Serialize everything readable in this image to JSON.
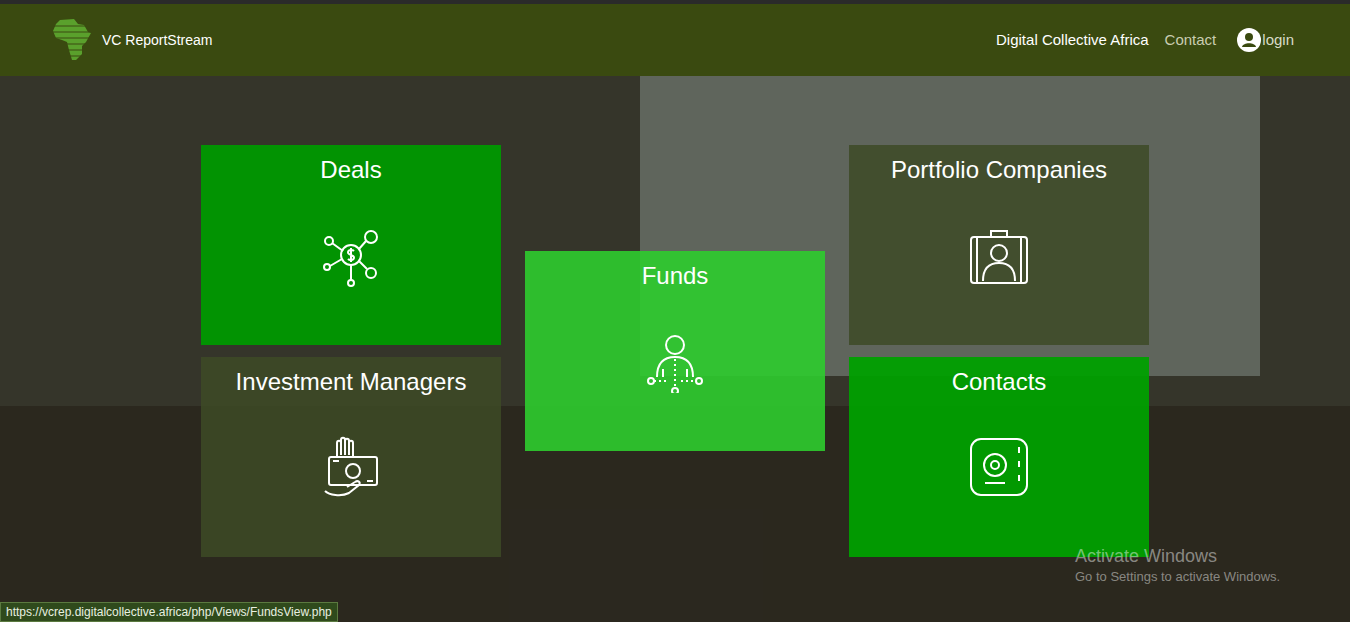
{
  "header": {
    "brand": "VC ReportStream",
    "nav": [
      {
        "label": "Digital Collective Africa",
        "selected": true
      },
      {
        "label": "Contact",
        "selected": false
      }
    ],
    "login": "login"
  },
  "tiles": [
    {
      "title": "Deals",
      "color": "#009900f2"
    },
    {
      "title": "Investment Managers",
      "color": "#3d4a26d9"
    },
    {
      "title": "Funds",
      "color": "#2ecc2ee6"
    },
    {
      "title": "Portfolio Companies",
      "color": "#3d4a26d9"
    },
    {
      "title": "Contacts",
      "color": "#00a000f0"
    }
  ],
  "status_bar": "https://vcrep.digitalcollective.africa/php/Views/FundsView.php",
  "watermark": {
    "title": "Activate Windows",
    "subtitle": "Go to Settings to activate Windows."
  }
}
